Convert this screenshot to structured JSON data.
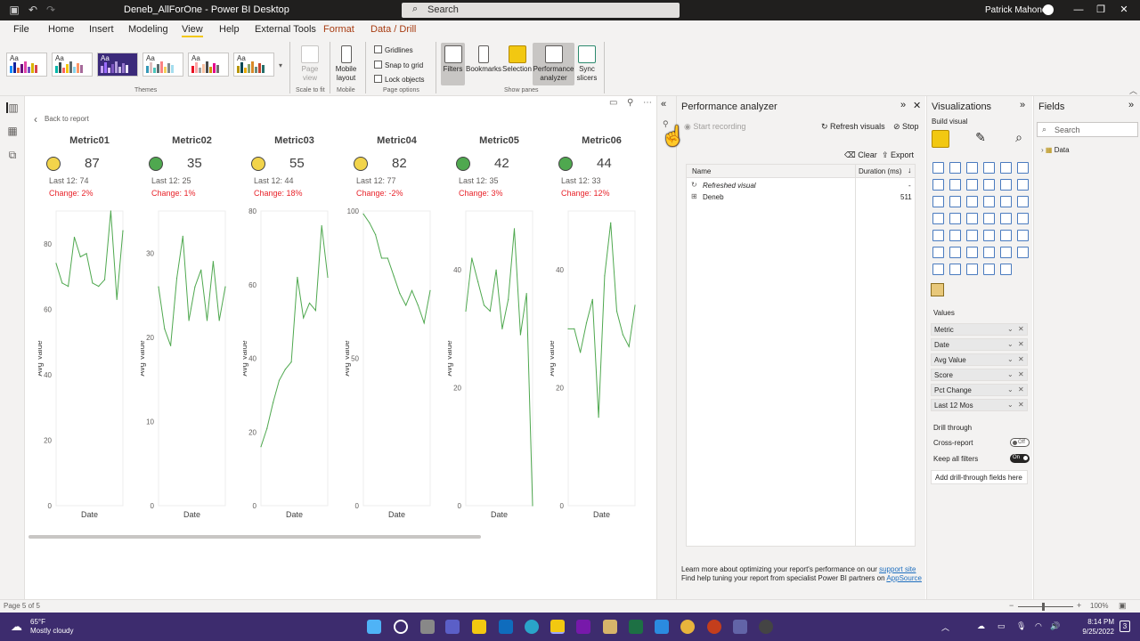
{
  "titlebar": {
    "title": "Deneb_AllForOne - Power BI Desktop",
    "search_placeholder": "Search",
    "user": "Patrick Mahoney"
  },
  "menu": [
    "File",
    "Home",
    "Insert",
    "Modeling",
    "View",
    "Help",
    "External Tools",
    "Format",
    "Data / Drill"
  ],
  "menu_active": "View",
  "ribbon": {
    "themes_label": "Themes",
    "page_view": "Page view",
    "scale_label": "Scale to fit",
    "mobile_layout": "Mobile layout",
    "mobile_label": "Mobile",
    "gridlines": "Gridlines",
    "snap": "Snap to grid",
    "lock": "Lock objects",
    "page_options_label": "Page options",
    "filters": "Filters",
    "bookmarks": "Bookmarks",
    "selection": "Selection",
    "performance": "Performance analyzer",
    "sync": "Sync slicers",
    "show_panes_label": "Show panes"
  },
  "canvas": {
    "back_label": "Back to report",
    "ylabel": "Avg Value",
    "xlabel": "Date",
    "page_indicator": "Page 5 of 5",
    "zoom": "100%"
  },
  "chart_data": [
    {
      "type": "line",
      "title": "Metric01",
      "score": "87",
      "status_color": "#f2d44b",
      "last12": "Last 12: 74",
      "change": "Change: 2%",
      "xlabel": "Date",
      "ylabel": "Avg Value",
      "ylim": [
        0,
        90
      ],
      "yticks": [
        0,
        20,
        40,
        60,
        80
      ],
      "values": [
        74,
        68,
        67,
        82,
        76,
        77,
        68,
        67,
        69,
        90,
        63,
        84
      ]
    },
    {
      "type": "line",
      "title": "Metric02",
      "score": "35",
      "status_color": "#4fa84f",
      "last12": "Last 12: 25",
      "change": "Change: 1%",
      "xlabel": "Date",
      "ylabel": "Avg Value",
      "ylim": [
        0,
        35
      ],
      "yticks": [
        0,
        10,
        20,
        30
      ],
      "values": [
        26,
        21,
        19,
        27,
        32,
        22,
        26,
        28,
        22,
        29,
        22,
        26
      ]
    },
    {
      "type": "line",
      "title": "Metric03",
      "score": "55",
      "status_color": "#f2d44b",
      "last12": "Last 12: 44",
      "change": "Change: 18%",
      "xlabel": "Date",
      "ylabel": "Avg Value",
      "ylim": [
        0,
        80
      ],
      "yticks": [
        0,
        20,
        40,
        60,
        80
      ],
      "values": [
        16,
        21,
        28,
        34,
        37,
        39,
        62,
        51,
        55,
        53,
        76,
        62
      ]
    },
    {
      "type": "line",
      "title": "Metric04",
      "score": "82",
      "status_color": "#f2d44b",
      "last12": "Last 12: 77",
      "change": "Change: -2%",
      "xlabel": "Date",
      "ylabel": "Avg Value",
      "ylim": [
        0,
        100
      ],
      "yticks": [
        0,
        50,
        100
      ],
      "values": [
        99,
        96,
        92,
        84,
        84,
        78,
        72,
        68,
        73,
        68,
        62,
        73
      ]
    },
    {
      "type": "line",
      "title": "Metric05",
      "score": "42",
      "status_color": "#4fa84f",
      "last12": "Last 12: 35",
      "change": "Change: 3%",
      "xlabel": "Date",
      "ylabel": "Avg Value",
      "ylim": [
        0,
        50
      ],
      "yticks": [
        0,
        20,
        40
      ],
      "values": [
        33,
        42,
        38,
        34,
        33,
        40,
        30,
        35,
        47,
        29,
        36,
        0
      ]
    },
    {
      "type": "line",
      "title": "Metric06",
      "score": "44",
      "status_color": "#4fa84f",
      "last12": "Last 12: 33",
      "change": "Change: 12%",
      "xlabel": "Date",
      "ylabel": "Avg Value",
      "ylim": [
        0,
        50
      ],
      "yticks": [
        0,
        20,
        40
      ],
      "values": [
        30,
        30,
        26,
        31,
        35,
        15,
        39,
        48,
        33,
        29,
        27,
        34
      ]
    }
  ],
  "performance": {
    "title": "Performance analyzer",
    "start": "Start recording",
    "refresh": "Refresh visuals",
    "stop": "Stop",
    "clear": "Clear",
    "export": "Export",
    "col_name": "Name",
    "col_duration": "Duration (ms)",
    "rows": [
      {
        "name": "Refreshed visual",
        "value": "-"
      },
      {
        "name": "Deneb",
        "value": "511"
      }
    ],
    "foot1": "Learn more about optimizing your report's performance on our ",
    "foot1_link": "support site",
    "foot2": "Find help tuning your report from specialist Power BI partners on ",
    "foot2_link": "AppSource"
  },
  "visualizations": {
    "title": "Visualizations",
    "build": "Build visual",
    "values_label": "Values",
    "wells": [
      "Metric",
      "Date",
      "Avg Value",
      "Score",
      "Pct Change",
      "Last 12 Mos"
    ],
    "drill_label": "Drill through",
    "cross_report": "Cross-report",
    "cross_state": "Off",
    "keep_filters": "Keep all filters",
    "keep_state": "On",
    "add_drill": "Add drill-through fields here"
  },
  "fields": {
    "title": "Fields",
    "search_placeholder": "Search",
    "table": "Data"
  },
  "taskbar": {
    "temp": "65°F",
    "weather": "Mostly cloudy",
    "time": "8:14 PM",
    "date": "9/25/2022",
    "notif": "3"
  }
}
